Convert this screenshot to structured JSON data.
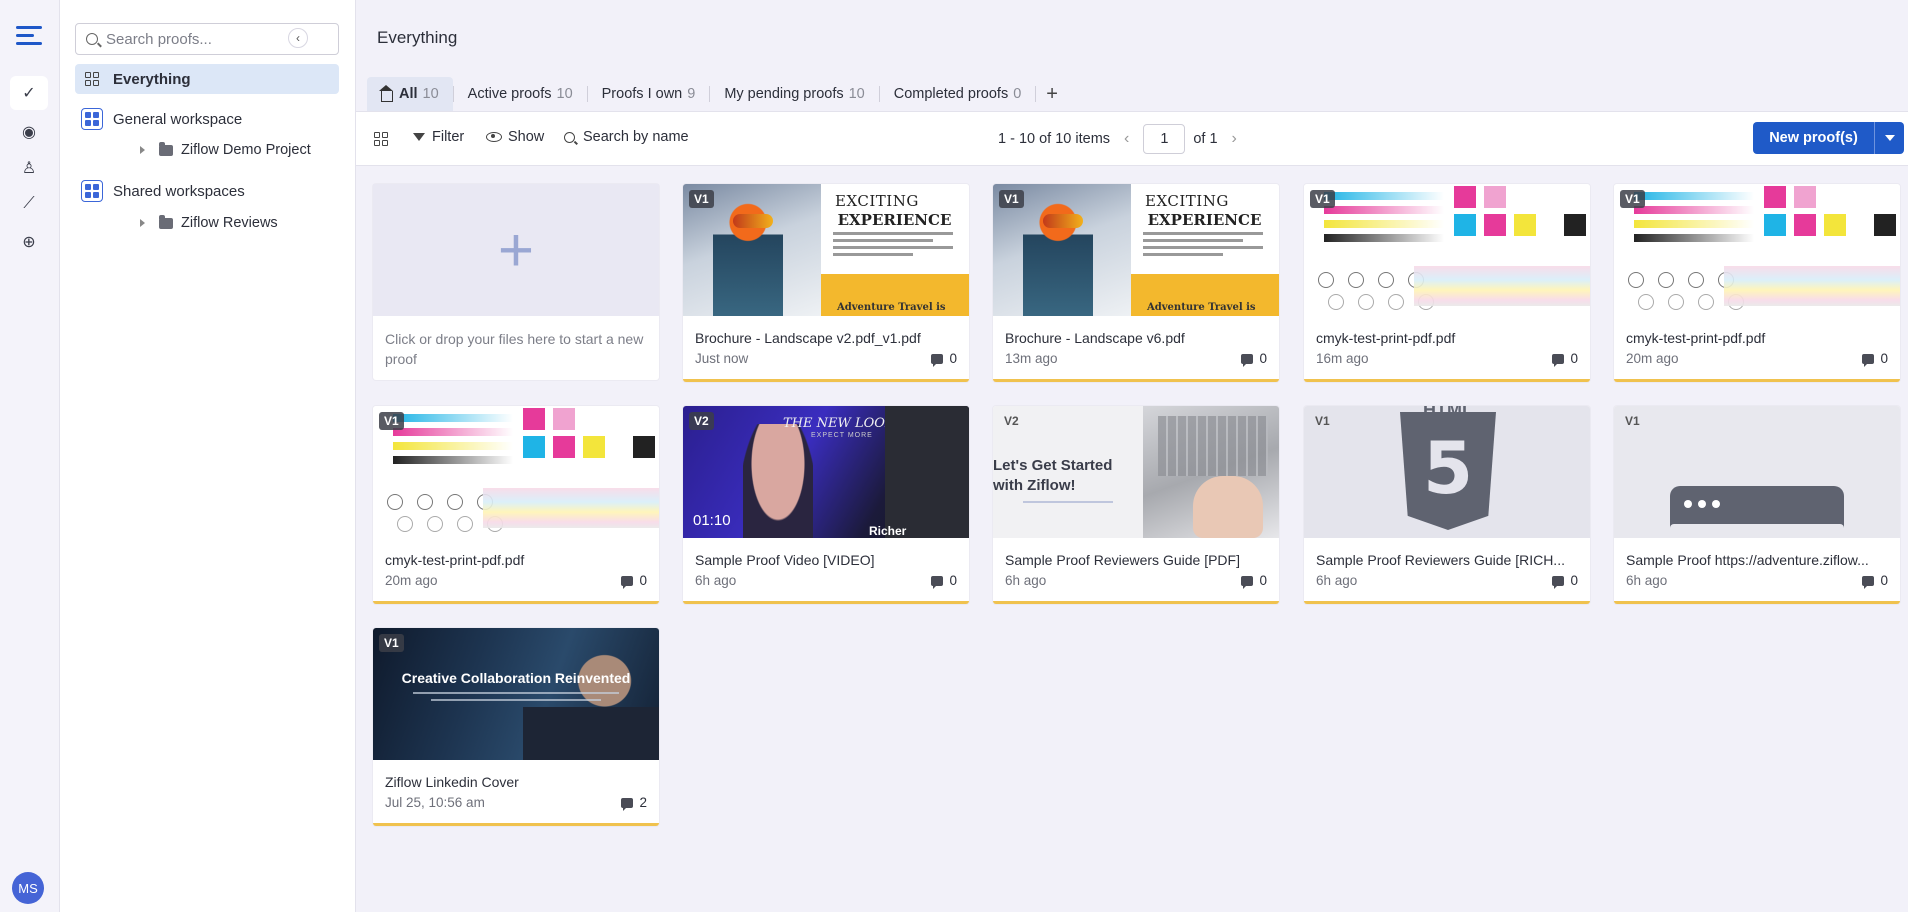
{
  "app": {
    "rail_icons": [
      "logo-icon",
      "check-icon",
      "eye-icon",
      "users-icon",
      "trend-icon",
      "plus-circle-icon"
    ],
    "avatar_initials": "MS",
    "accent": "#1f5ac8"
  },
  "sidebar": {
    "search_placeholder": "Search proofs...",
    "everything_label": "Everything",
    "general_workspace": "General workspace",
    "general_project": "Ziflow Demo Project",
    "shared_workspaces": "Shared workspaces",
    "shared_project": "Ziflow Reviews"
  },
  "main": {
    "title": "Everything",
    "tabs": [
      {
        "label": "All",
        "count": "10"
      },
      {
        "label": "Active proofs",
        "count": "10"
      },
      {
        "label": "Proofs I own",
        "count": "9"
      },
      {
        "label": "My pending proofs",
        "count": "10"
      },
      {
        "label": "Completed proofs",
        "count": "0"
      }
    ],
    "tab_add": "+"
  },
  "toolbar": {
    "filter": "Filter",
    "show": "Show",
    "search": "Search by name",
    "items_range": "1 - 10 of 10 items",
    "page": "1",
    "of_pages": "of 1",
    "new_proof": "New proof(s)"
  },
  "upload": {
    "plus": "+",
    "hint": "Click or drop your files here to start a new proof"
  },
  "cards": [
    {
      "version": "V1",
      "title": "Brochure - Landscape v2.pdf_v1.pdf",
      "time": "Just now",
      "comments": "0",
      "thumb_h": "EXCITING",
      "thumb_h2": "EXPERIENCE",
      "thumb_footer": "Adventure Travel is"
    },
    {
      "version": "V1",
      "title": "Brochure - Landscape v6.pdf",
      "time": "13m ago",
      "comments": "0",
      "thumb_h": "EXCITING",
      "thumb_h2": "EXPERIENCE",
      "thumb_footer": "Adventure Travel is"
    },
    {
      "version": "V1",
      "title": "cmyk-test-print-pdf.pdf",
      "time": "16m ago",
      "comments": "0"
    },
    {
      "version": "V1",
      "title": "cmyk-test-print-pdf.pdf",
      "time": "20m ago",
      "comments": "0"
    },
    {
      "version": "V1",
      "title": "cmyk-test-print-pdf.pdf",
      "time": "20m ago",
      "comments": "0"
    },
    {
      "version": "V2",
      "title": "Sample Proof Video [VIDEO]",
      "time": "6h ago",
      "comments": "0",
      "duration": "01:10",
      "thumb_h": "THE NEW LOOK",
      "thumb_sub": "EXPECT MORE",
      "thumb_footer": "Richer discussion"
    },
    {
      "version": "V2",
      "title": "Sample Proof Reviewers Guide [PDF]",
      "time": "6h ago",
      "comments": "0",
      "thumb_h": "Let's Get Started",
      "thumb_h2": "with Ziflow!"
    },
    {
      "version": "V1",
      "title": "Sample Proof Reviewers Guide [RICH...",
      "time": "6h ago",
      "comments": "0",
      "thumb_h": "HTML",
      "thumb_h2": "5"
    },
    {
      "version": "V1",
      "title": "Sample Proof https://adventure.ziflow...",
      "time": "6h ago",
      "comments": "0"
    },
    {
      "version": "V1",
      "title": "Ziflow Linkedin Cover",
      "time": "Jul 25, 10:56 am",
      "comments": "2",
      "thumb_h": "Creative Collaboration Reinvented"
    }
  ]
}
